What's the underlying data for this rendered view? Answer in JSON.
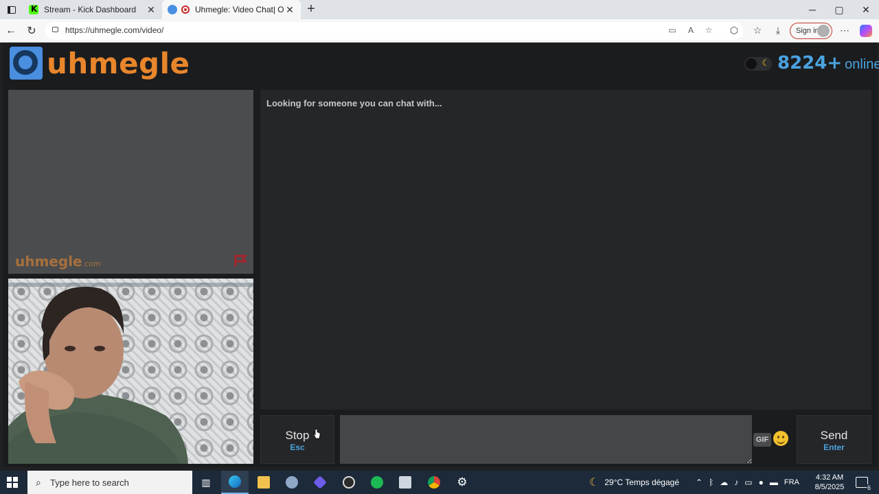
{
  "browser": {
    "tabs": [
      {
        "title": "Stream - Kick Dashboard",
        "active": false
      },
      {
        "title": "Uhmegle: Video Chat| Omegle",
        "active": true
      }
    ],
    "url": "https://uhmegle.com/video/",
    "sign_in_label": "Sign in"
  },
  "site": {
    "logo_text": "uhmegle",
    "online_count": "8224+",
    "online_label": "online",
    "theme_toggle": "dark-mode-toggle",
    "stranger_watermark_main": "uhmegle",
    "stranger_watermark_suffix": ".com"
  },
  "chat": {
    "status_text": "Looking for someone you can chat with...",
    "message_value": "",
    "stop_label": "Stop",
    "stop_key": "Esc",
    "gif_label": "GIF",
    "send_label": "Send",
    "send_key": "Enter"
  },
  "taskbar": {
    "search_placeholder": "Type here to search",
    "weather": "29°C  Temps dégagé",
    "language": "FRA",
    "time": "4:32 AM",
    "date": "8/5/2025",
    "notifications": "6"
  },
  "colors": {
    "accent_blue": "#4aa3e0",
    "logo_orange": "#e8862c",
    "page_bg": "#1b1c1e"
  }
}
